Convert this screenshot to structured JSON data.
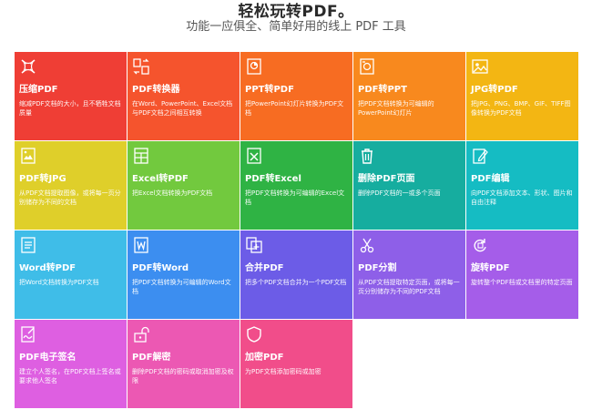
{
  "header": {
    "title": "轻松玩转PDF。",
    "subtitle": "功能一应俱全、简单好用的线上 PDF 工具"
  },
  "tools": [
    {
      "name": "压缩PDF",
      "desc": "缩减PDF文档的大小，且不牺牲文档质量",
      "color": "#ef3e35",
      "icon": "compress-icon"
    },
    {
      "name": "PDF转换器",
      "desc": "在Word、PowerPoint、Excel文档与PDF文档之间相互转换",
      "color": "#f5542d",
      "icon": "convert-icon"
    },
    {
      "name": "PPT转PDF",
      "desc": "把PowerPoint幻灯片转换为PDF文档",
      "color": "#f76c22",
      "icon": "ppt-icon"
    },
    {
      "name": "PDF转PPT",
      "desc": "把PDF文档转换为可编辑的PowerPoint幻灯片",
      "color": "#f8891e",
      "icon": "pdf-to-ppt-icon"
    },
    {
      "name": "JPG转PDF",
      "desc": "把JPG、PNG、BMP、GIF、TIFF图像转换为PDF文档",
      "color": "#f3b613",
      "icon": "image-icon"
    },
    {
      "name": "PDF转JPG",
      "desc": "从PDF文档提取图像，或将每一页分别储存为不同的文档",
      "color": "#dfcf2a",
      "icon": "pdf-to-image-icon"
    },
    {
      "name": "Excel转PDF",
      "desc": "把Excel文档转换为PDF文档",
      "color": "#72c93e",
      "icon": "excel-icon"
    },
    {
      "name": "PDF转Excel",
      "desc": "把PDF文档转换为可编辑的Excel文档",
      "color": "#2fb344",
      "icon": "pdf-to-excel-icon"
    },
    {
      "name": "删除PDF页面",
      "desc": "删除PDF文档的一或多个页面",
      "color": "#16ad9f",
      "icon": "trash-icon"
    },
    {
      "name": "PDF编辑",
      "desc": "向PDF文档添加文本、形状、图片和自由注释",
      "color": "#15bcc3",
      "icon": "edit-icon"
    },
    {
      "name": "Word转PDF",
      "desc": "把Word文档转换为PDF文档",
      "color": "#3fbde8",
      "icon": "word-icon"
    },
    {
      "name": "PDF转Word",
      "desc": "把PDF文档转换为可编辑的Word文档",
      "color": "#3c8ef0",
      "icon": "pdf-to-word-icon"
    },
    {
      "name": "合并PDF",
      "desc": "把多个PDF文档合并为一个PDF文档",
      "color": "#6c5ce7",
      "icon": "merge-icon"
    },
    {
      "name": "PDF分割",
      "desc": "从PDF文档提取特定页面，或将每一页分别储存为不同的PDF文档",
      "color": "#8e5fe8",
      "icon": "scissors-icon"
    },
    {
      "name": "旋转PDF",
      "desc": "旋转整个PDF档或文档里的特定页面",
      "color": "#a55de9",
      "icon": "rotate-icon"
    },
    {
      "name": "PDF电子签名",
      "desc": "建立个人签名，在PDF文档上签名或要求他人签名",
      "color": "#de5fe1",
      "icon": "signature-icon"
    },
    {
      "name": "PDF解密",
      "desc": "删除PDF文档的密码或取消加密及权限",
      "color": "#ec58b3",
      "icon": "unlock-icon"
    },
    {
      "name": "加密PDF",
      "desc": "为PDF文档添加密码或加密",
      "color": "#f14d8a",
      "icon": "shield-icon"
    }
  ]
}
